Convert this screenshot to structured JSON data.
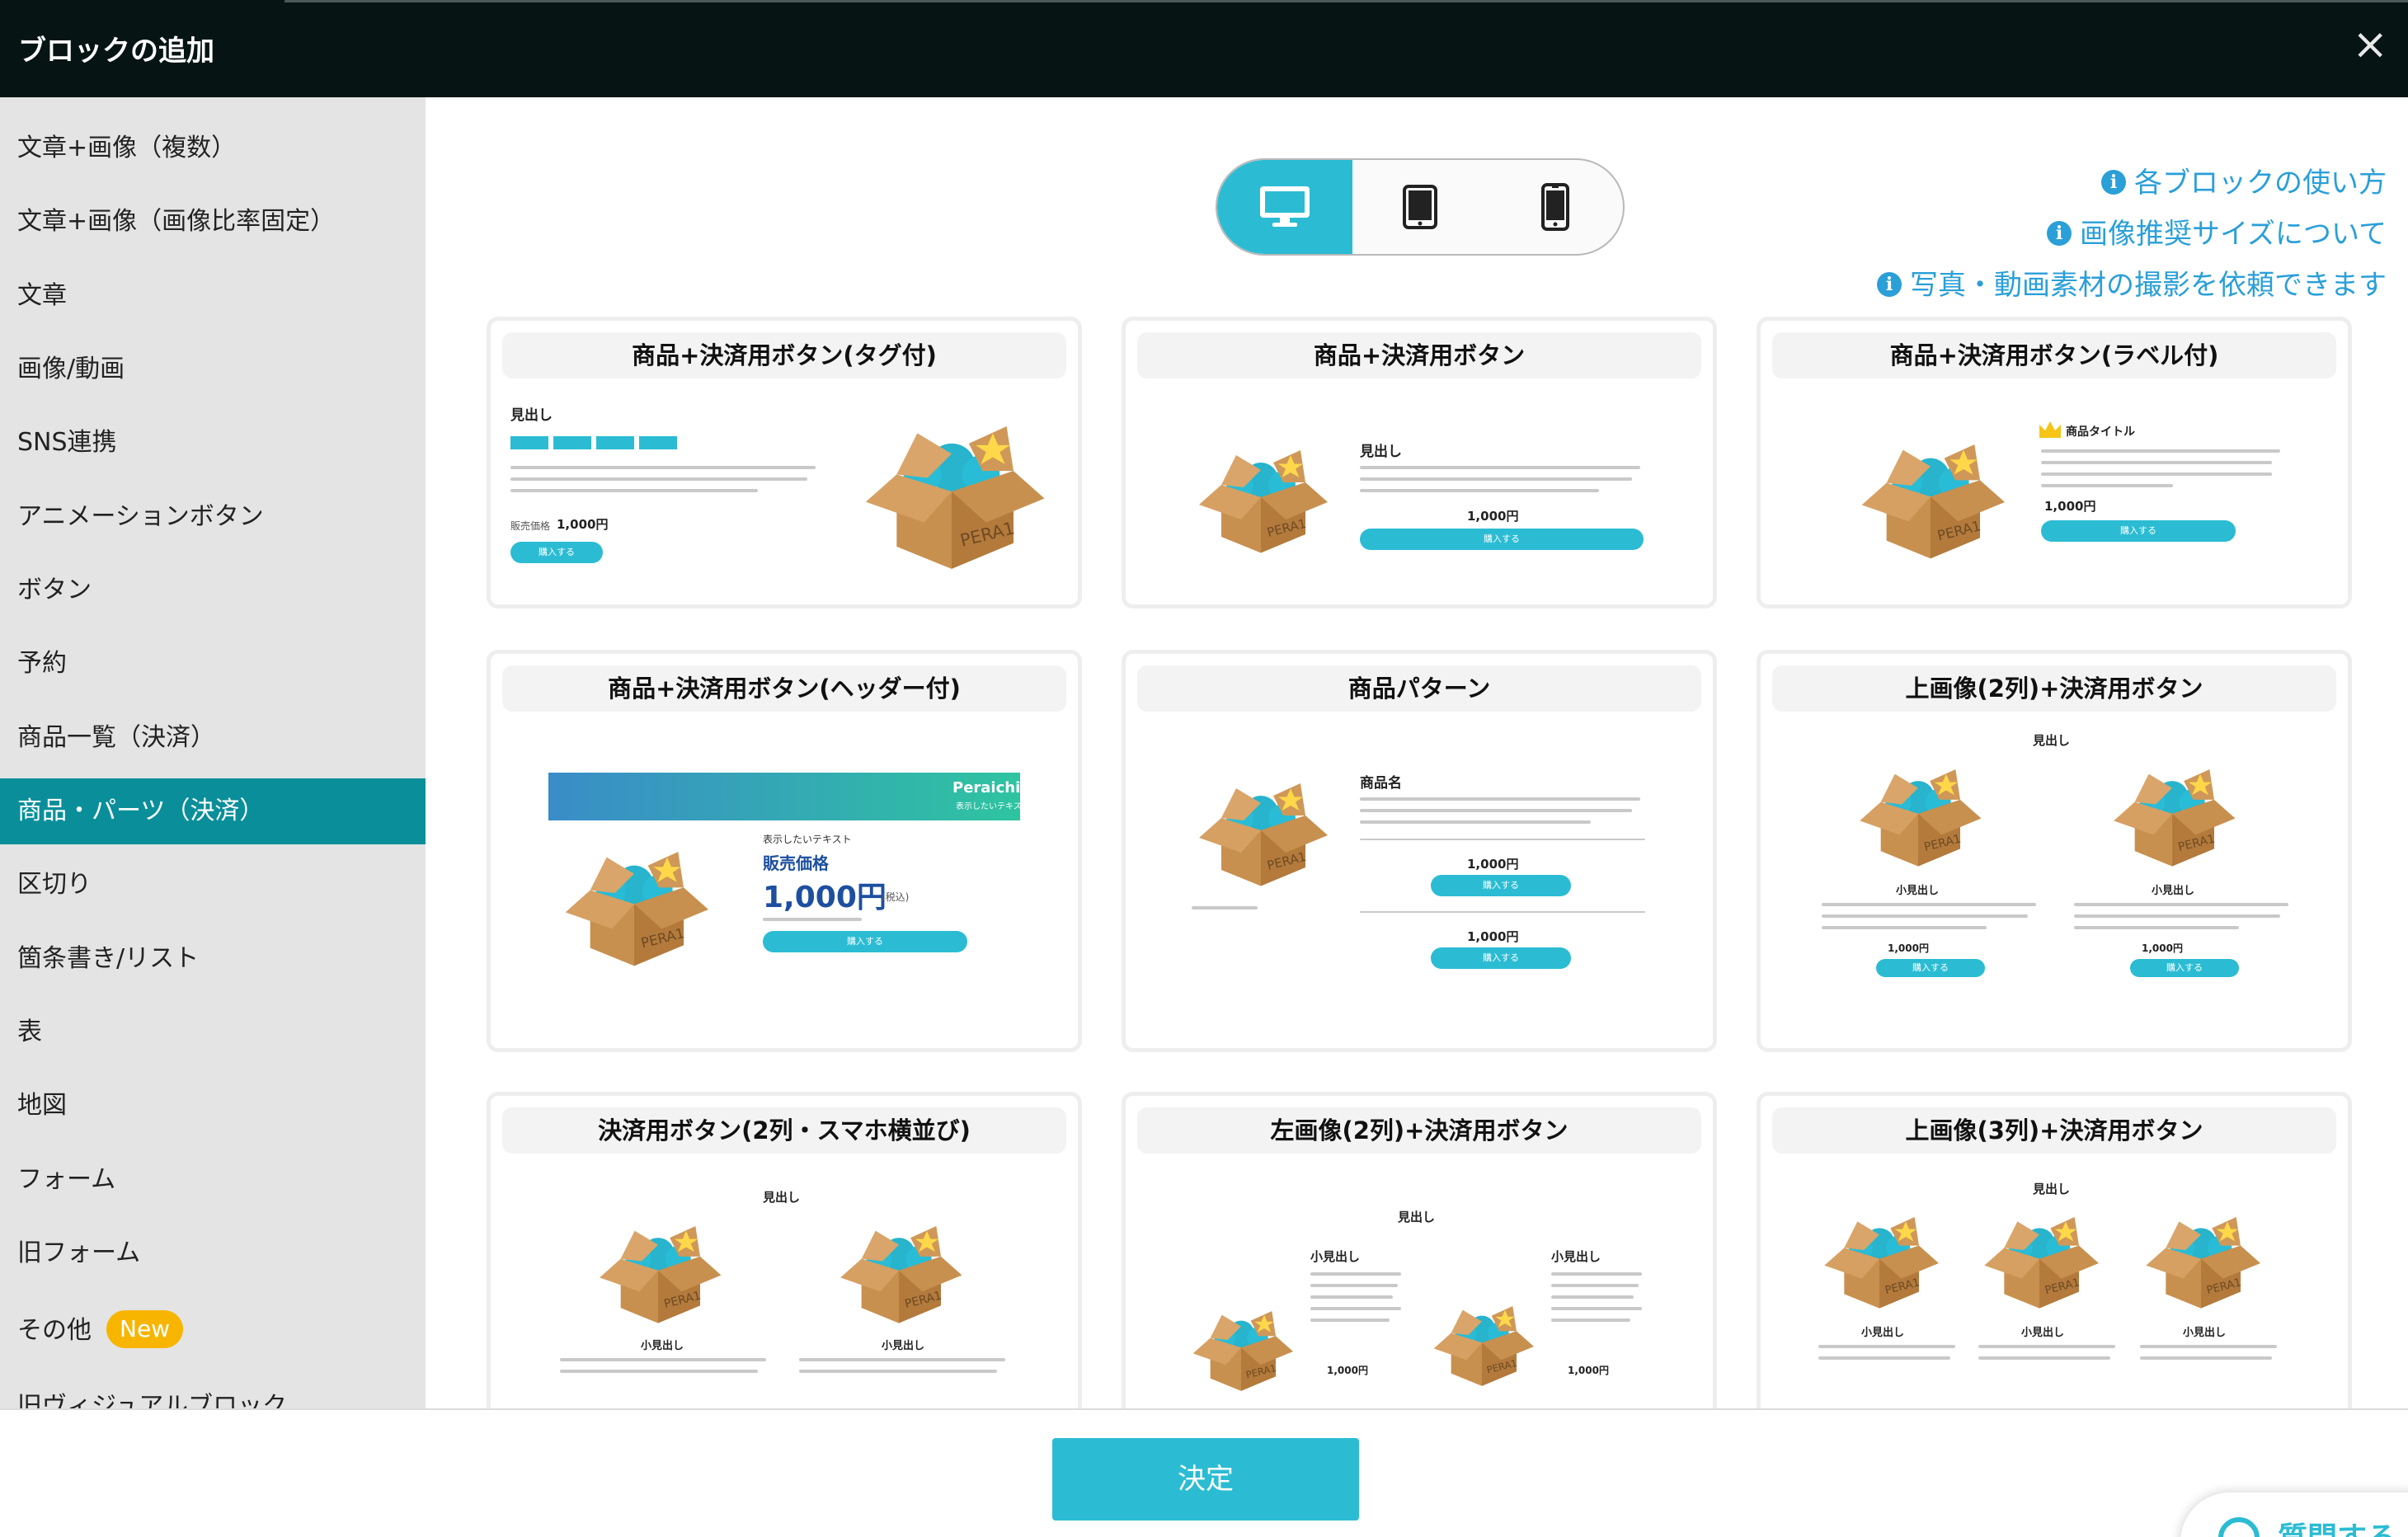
{
  "header": {
    "title": "ブロックの追加",
    "close_label": "×"
  },
  "sidebar": {
    "items": [
      {
        "label": "文章+画像（複数）",
        "active": false
      },
      {
        "label": "文章+画像（画像比率固定）",
        "active": false
      },
      {
        "label": "文章",
        "active": false
      },
      {
        "label": "画像/動画",
        "active": false
      },
      {
        "label": "SNS連携",
        "active": false
      },
      {
        "label": "アニメーションボタン",
        "active": false
      },
      {
        "label": "ボタン",
        "active": false
      },
      {
        "label": "予約",
        "active": false
      },
      {
        "label": "商品一覧（決済）",
        "active": false
      },
      {
        "label": "商品・パーツ（決済）",
        "active": true
      },
      {
        "label": "区切り",
        "active": false
      },
      {
        "label": "箇条書き/リスト",
        "active": false
      },
      {
        "label": "表",
        "active": false
      },
      {
        "label": "地図",
        "active": false
      },
      {
        "label": "フォーム",
        "active": false
      },
      {
        "label": "旧フォーム",
        "active": false
      },
      {
        "label": "その他",
        "active": false,
        "badge": "New"
      },
      {
        "label": "旧ヴィジュアルブロック",
        "active": false
      }
    ]
  },
  "device_toggle": {
    "selected": "desktop",
    "options": [
      "desktop-icon",
      "tablet-icon",
      "smartphone-icon"
    ]
  },
  "help_links": [
    {
      "label": "各ブロックの使い方"
    },
    {
      "label": "画像推奨サイズについて"
    },
    {
      "label": "写真・動画素材の撮影を依頼できます"
    }
  ],
  "cards": [
    {
      "title": "商品+決済用ボタン(タグ付)"
    },
    {
      "title": "商品+決済用ボタン"
    },
    {
      "title": "商品+決済用ボタン(ラベル付)"
    },
    {
      "title": "商品+決済用ボタン(ヘッダー付)"
    },
    {
      "title": "商品パターン"
    },
    {
      "title": "上画像(2列)+決済用ボタン"
    },
    {
      "title": "決済用ボタン(2列・スマホ横並び)"
    },
    {
      "title": "左画像(2列)+決済用ボタン"
    },
    {
      "title": "上画像(3列)+決済用ボタン"
    }
  ],
  "preview_text": {
    "heading": "見出し",
    "sub_heading": "小見出し",
    "product_title": "商品タイトル",
    "product_name": "商品名",
    "buy": "購入する",
    "price": "1,000円",
    "price_prefix": "販売価格",
    "tax": "(税込)",
    "banner_brand": "Peraichi",
    "banner_sub": "表示したいテキスト",
    "display_text": "表示したいテキスト",
    "sale_price": "販売価格",
    "big_price": "1,000円"
  },
  "footer": {
    "confirm_label": "決定",
    "question_label": "質問する"
  },
  "colors": {
    "accent": "#2bbcd3",
    "active_sidebar": "#0a8f9a",
    "header": "#061413",
    "link": "#2a9fd8",
    "badge": "#f7b500"
  }
}
